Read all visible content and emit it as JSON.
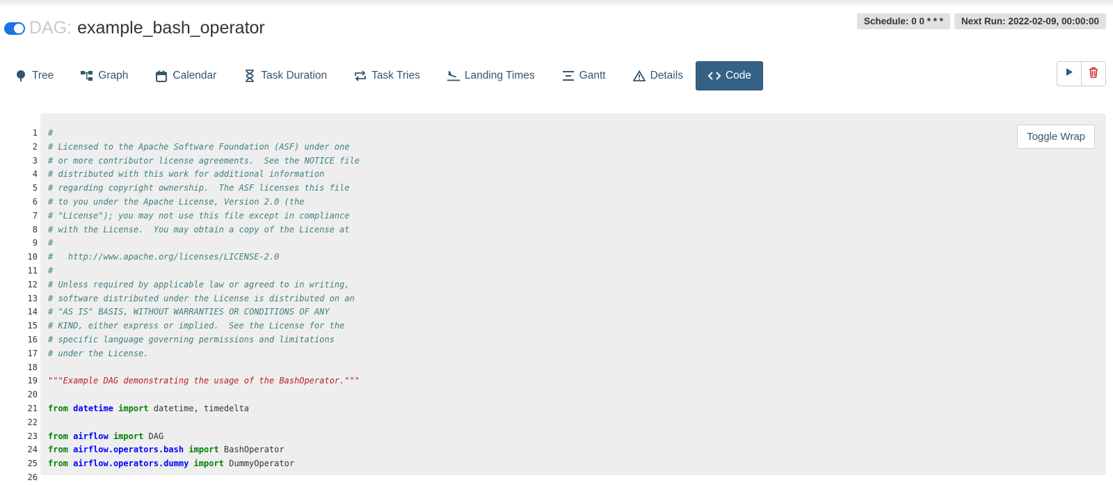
{
  "header": {
    "dag_label": "DAG:",
    "dag_id": "example_bash_operator",
    "schedule": "Schedule: 0 0 * * *",
    "next_run": "Next Run: 2022-02-09, 00:00:00"
  },
  "nav": [
    {
      "label": "Tree",
      "icon": "tree-icon"
    },
    {
      "label": "Graph",
      "icon": "graph-icon"
    },
    {
      "label": "Calendar",
      "icon": "calendar-icon"
    },
    {
      "label": "Task Duration",
      "icon": "hourglass-icon"
    },
    {
      "label": "Task Tries",
      "icon": "repeat-icon"
    },
    {
      "label": "Landing Times",
      "icon": "plane-landing-icon"
    },
    {
      "label": "Gantt",
      "icon": "gantt-icon"
    },
    {
      "label": "Details",
      "icon": "warning-triangle-icon"
    },
    {
      "label": "Code",
      "icon": "code-icon",
      "active": true
    }
  ],
  "actions": {
    "trigger": "play-icon",
    "delete": "trash-icon"
  },
  "code": {
    "toggle_wrap": "Toggle Wrap",
    "lines": [
      {
        "n": "1",
        "parts": [
          [
            "cmt",
            "#"
          ]
        ]
      },
      {
        "n": "2",
        "parts": [
          [
            "cmt",
            "# Licensed to the Apache Software Foundation (ASF) under one"
          ]
        ]
      },
      {
        "n": "3",
        "parts": [
          [
            "cmt",
            "# or more contributor license agreements.  See the NOTICE file"
          ]
        ]
      },
      {
        "n": "4",
        "parts": [
          [
            "cmt",
            "# distributed with this work for additional information"
          ]
        ]
      },
      {
        "n": "5",
        "parts": [
          [
            "cmt",
            "# regarding copyright ownership.  The ASF licenses this file"
          ]
        ]
      },
      {
        "n": "6",
        "parts": [
          [
            "cmt",
            "# to you under the Apache License, Version 2.0 (the"
          ]
        ]
      },
      {
        "n": "7",
        "parts": [
          [
            "cmt",
            "# \"License\"); you may not use this file except in compliance"
          ]
        ]
      },
      {
        "n": "8",
        "parts": [
          [
            "cmt",
            "# with the License.  You may obtain a copy of the License at"
          ]
        ]
      },
      {
        "n": "9",
        "parts": [
          [
            "cmt",
            "#"
          ]
        ]
      },
      {
        "n": "10",
        "parts": [
          [
            "cmt",
            "#   http://www.apache.org/licenses/LICENSE-2.0"
          ]
        ]
      },
      {
        "n": "11",
        "parts": [
          [
            "cmt",
            "#"
          ]
        ]
      },
      {
        "n": "12",
        "parts": [
          [
            "cmt",
            "# Unless required by applicable law or agreed to in writing,"
          ]
        ]
      },
      {
        "n": "13",
        "parts": [
          [
            "cmt",
            "# software distributed under the License is distributed on an"
          ]
        ]
      },
      {
        "n": "14",
        "parts": [
          [
            "cmt",
            "# \"AS IS\" BASIS, WITHOUT WARRANTIES OR CONDITIONS OF ANY"
          ]
        ]
      },
      {
        "n": "15",
        "parts": [
          [
            "cmt",
            "# KIND, either express or implied.  See the License for the"
          ]
        ]
      },
      {
        "n": "16",
        "parts": [
          [
            "cmt",
            "# specific language governing permissions and limitations"
          ]
        ]
      },
      {
        "n": "17",
        "parts": [
          [
            "cmt",
            "# under the License."
          ]
        ]
      },
      {
        "n": "18",
        "parts": []
      },
      {
        "n": "19",
        "parts": [
          [
            "str",
            "\"\"\"Example DAG demonstrating the usage of the BashOperator.\"\"\""
          ]
        ]
      },
      {
        "n": "20",
        "parts": []
      },
      {
        "n": "21",
        "parts": [
          [
            "kw",
            "from"
          ],
          [
            "txt",
            " "
          ],
          [
            "mod",
            "datetime"
          ],
          [
            "txt",
            " "
          ],
          [
            "kw",
            "import"
          ],
          [
            "txt",
            " datetime, timedelta"
          ]
        ]
      },
      {
        "n": "22",
        "parts": []
      },
      {
        "n": "23",
        "parts": [
          [
            "kw",
            "from"
          ],
          [
            "txt",
            " "
          ],
          [
            "mod",
            "airflow"
          ],
          [
            "txt",
            " "
          ],
          [
            "kw",
            "import"
          ],
          [
            "txt",
            " DAG"
          ]
        ]
      },
      {
        "n": "24",
        "parts": [
          [
            "kw",
            "from"
          ],
          [
            "txt",
            " "
          ],
          [
            "mod",
            "airflow.operators.bash"
          ],
          [
            "txt",
            " "
          ],
          [
            "kw",
            "import"
          ],
          [
            "txt",
            " BashOperator"
          ]
        ]
      },
      {
        "n": "25",
        "parts": [
          [
            "kw",
            "from"
          ],
          [
            "txt",
            " "
          ],
          [
            "mod",
            "airflow.operators.dummy"
          ],
          [
            "txt",
            " "
          ],
          [
            "kw",
            "import"
          ],
          [
            "txt",
            " DummyOperator"
          ]
        ]
      },
      {
        "n": "26",
        "parts": []
      }
    ]
  }
}
